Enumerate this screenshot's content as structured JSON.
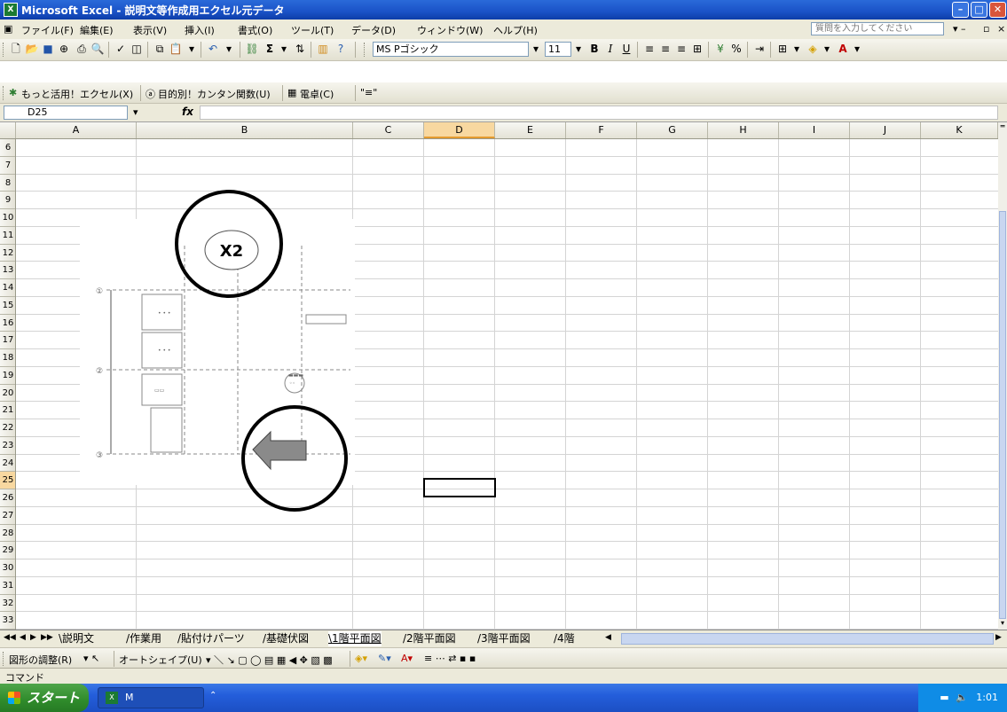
{
  "window": {
    "title": "Microsoft Excel - 説明文等作成用エクセル元データ",
    "app_icon": "excel-icon",
    "buttons": [
      "minimize-icon",
      "maximize-icon",
      "close-icon"
    ]
  },
  "menu": {
    "items": [
      "ファイル(F)",
      "編集(E)",
      "表示(V)",
      "挿入(I)",
      "書式(O)",
      "ツール(T)",
      "データ(D)",
      "ウィンドウ(W)",
      "ヘルプ(H)"
    ],
    "help_placeholder": "質問を入力してください"
  },
  "toolbar": {
    "font_name": "MS Pゴシック",
    "font_size": "11",
    "bold": "B",
    "italic": "I",
    "underline": "U",
    "percent": "%",
    "sum": "Σ"
  },
  "toolbar2": {
    "more_excel": "もっと活用！エクセル(X)",
    "func_guide": "目的別！カンタン関数(U)",
    "calculator": "電卓(C)"
  },
  "formula_bar": {
    "name_box": "D25",
    "fx": "fx",
    "value": ""
  },
  "columns": [
    "A",
    "B",
    "C",
    "D",
    "E",
    "F",
    "G",
    "H",
    "I",
    "J",
    "K"
  ],
  "selected_column": "D",
  "rows": [
    "6",
    "7",
    "8",
    "9",
    "10",
    "11",
    "12",
    "13",
    "14",
    "15",
    "16",
    "17",
    "18",
    "19",
    "20",
    "21",
    "22",
    "23",
    "24",
    "25",
    "26",
    "27",
    "28",
    "29",
    "30",
    "31",
    "32",
    "33"
  ],
  "selected_row": "25",
  "image": {
    "label_x2": "X2",
    "arrow": "left-arrow",
    "note_axis_top": "①",
    "note_axis_mid": "②",
    "note_axis_bottom": "③"
  },
  "sheets": {
    "tabs": [
      "説明文",
      "作業用",
      "貼付けパーツ",
      "基礎伏図",
      "1階平面図",
      "2階平面図",
      "3階平面図",
      "4階"
    ],
    "active": "1階平面図"
  },
  "drawing_toolbar": {
    "draw": "図形の調整(R)",
    "autoshape": "オートシェイプ(U)"
  },
  "status": {
    "mode": "コマンド"
  },
  "taskbar": {
    "start": "スタート",
    "item": "M",
    "time": "1:01"
  }
}
